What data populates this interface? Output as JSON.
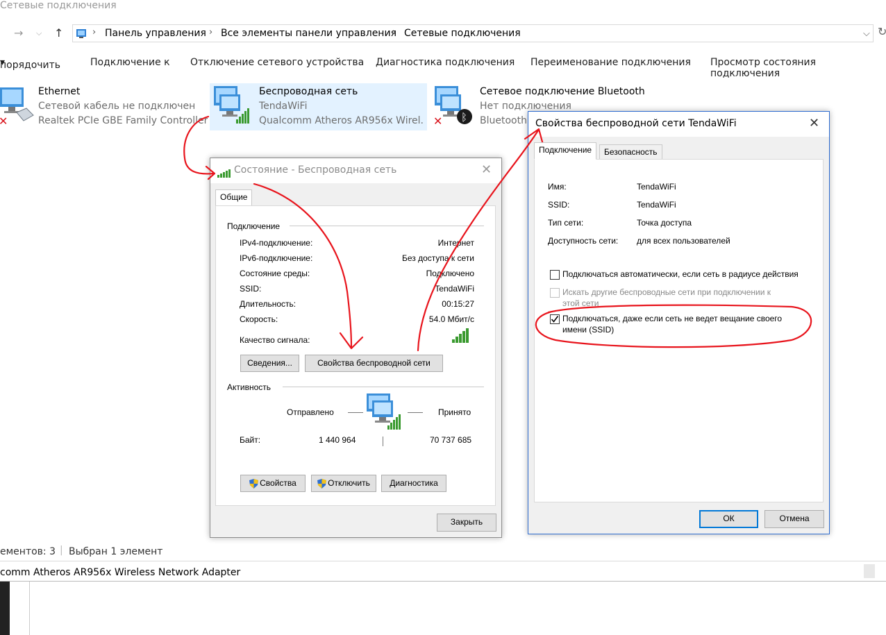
{
  "window": {
    "title": "Сетевые подключения"
  },
  "address": {
    "crumbs": [
      "Панель управления",
      "Все элементы панели управления",
      "Сетевые подключения"
    ]
  },
  "toolbar": {
    "items": [
      "порядочить",
      "Подключение к",
      "Отключение сетевого устройства",
      "Диагностика подключения",
      "Переименование подключения",
      "Просмотр состояния подключения"
    ]
  },
  "adapters": [
    {
      "name": "Ethernet",
      "status": "Сетевой кабель не подключен",
      "device": "Realtek PCIe GBE Family Controller"
    },
    {
      "name": "Беспроводная сеть",
      "status": "TendaWiFi",
      "device": "Qualcomm Atheros AR956x Wirel..."
    },
    {
      "name": "Сетевое подключение Bluetooth",
      "status": "Нет подключения",
      "device": "Bluetooth"
    }
  ],
  "statusbar": {
    "count": "ементов: 3",
    "selected": "Выбран 1 элемент",
    "details": "comm Atheros AR956x Wireless Network Adapter"
  },
  "status_dialog": {
    "title": "Состояние - Беспроводная сеть",
    "tab": "Общие",
    "section_connection": "Подключение",
    "rows": [
      {
        "label": "IPv4-подключение:",
        "value": "Интернет"
      },
      {
        "label": "IPv6-подключение:",
        "value": "Без доступа к сети"
      },
      {
        "label": "Состояние среды:",
        "value": "Подключено"
      },
      {
        "label": "SSID:",
        "value": "TendaWiFi"
      },
      {
        "label": "Длительность:",
        "value": "00:15:27"
      },
      {
        "label": "Скорость:",
        "value": "54.0 Мбит/с"
      }
    ],
    "signal_label": "Качество сигнала:",
    "details_btn": "Сведения...",
    "wireless_props_btn": "Свойства беспроводной сети",
    "section_activity": "Активность",
    "sent_label": "Отправлено",
    "received_label": "Принято",
    "bytes_label": "Байт:",
    "bytes_sent": "1 440 964",
    "bytes_received": "70 737 685",
    "props_btn": "Свойства",
    "disable_btn": "Отключить",
    "diag_btn": "Диагностика",
    "close_btn": "Закрыть"
  },
  "props_dialog": {
    "title": "Свойства беспроводной сети TendaWiFi",
    "tab_connection": "Подключение",
    "tab_security": "Безопасность",
    "fields": [
      {
        "label": "Имя:",
        "value": "TendaWiFi"
      },
      {
        "label": "SSID:",
        "value": "TendaWiFi"
      },
      {
        "label": "Тип сети:",
        "value": "Точка доступа"
      },
      {
        "label": "Доступность сети:",
        "value": "для всех пользователей"
      }
    ],
    "cb_auto": "Подключаться автоматически, если сеть в радиусе действия",
    "cb_other_1": "Искать другие беспроводные сети при подключении к",
    "cb_other_2": "этой сети",
    "cb_hidden_1": "Подключаться, даже если сеть не ведет вещание своего",
    "cb_hidden_2": "имени (SSID)",
    "ok_btn": "ОК",
    "cancel_btn": "Отмена"
  },
  "colors": {
    "annotation": "#e8141c",
    "selection": "#cce8ff",
    "signal": "#3a9a2f"
  }
}
